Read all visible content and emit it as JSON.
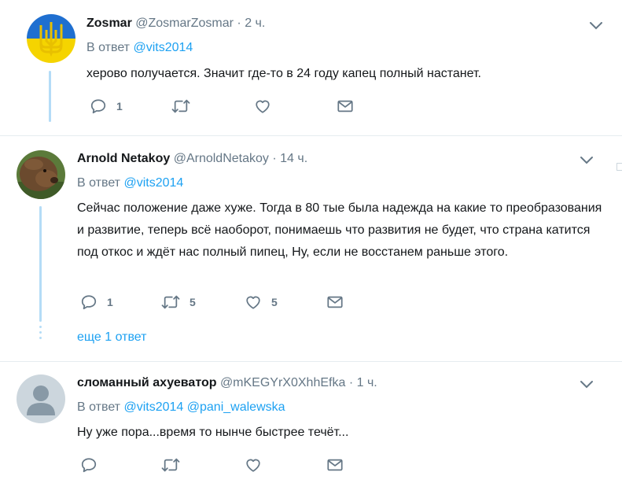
{
  "tweets": [
    {
      "name": "Zosmar",
      "handle": "@ZosmarZosmar",
      "time": "2 ч.",
      "reply_prefix": "В ответ",
      "reply_to": [
        "@vits2014"
      ],
      "text": "херово получается. Значит где-то в 24 году капец полный настанет.",
      "replies": "1",
      "retweets": "",
      "likes": ""
    },
    {
      "name": "Arnold Netakoy",
      "handle": "@ArnoldNetakoy",
      "time": "14 ч.",
      "reply_prefix": "В ответ",
      "reply_to": [
        "@vits2014"
      ],
      "text": "Сейчас положение даже хуже. Тогда в 80 тые была надежда на какие то преобразования и развитие, теперь всё наоборот, понимаешь что развития не будет, что страна катится под откос и ждёт нас полный пипец, Ну, если не восстанем раньше этого.",
      "replies": "1",
      "retweets": "5",
      "likes": "5",
      "more_replies": "еще 1 ответ"
    },
    {
      "name": "сломанный ахуеватор",
      "handle": "@mKEGYrX0XhhEfka",
      "time": "1 ч.",
      "reply_prefix": "В ответ",
      "reply_to": [
        "@vits2014",
        "@pani_walewska"
      ],
      "text": "Ну уже пора...время то нынче быстрее течёт...",
      "replies": "",
      "retweets": "",
      "likes": ""
    }
  ],
  "separator": "·",
  "colors": {
    "accent": "#1da1f2",
    "secondary_text": "#657786",
    "thread_line": "#b4dcf7",
    "flag_blue": "#1f6fd0",
    "flag_yellow": "#f5d400"
  },
  "icons": [
    "reply-icon",
    "retweet-icon",
    "like-icon",
    "message-icon",
    "chevron-down-icon"
  ]
}
